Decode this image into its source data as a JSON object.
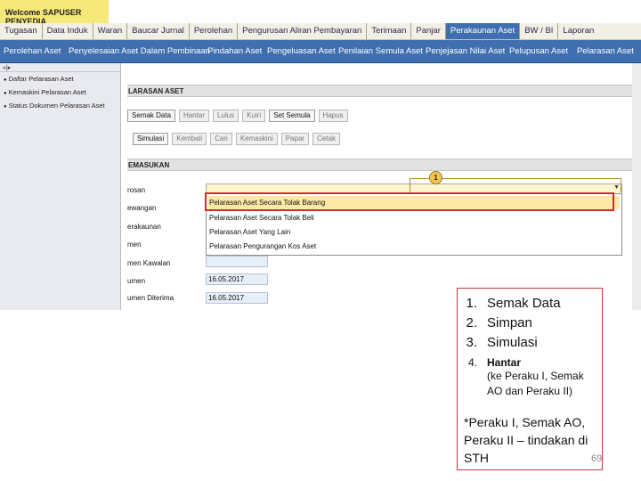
{
  "welcome": "Welcome SAPUSER PENYEDIA",
  "modules": [
    "Tugasan",
    "Data Induk",
    "Waran",
    "Baucar Jurnal",
    "Perolehan",
    "Pengurusan Aliran Pembayaran",
    "Terimaan",
    "Panjar",
    "Perakaunan Aset",
    "BW / BI",
    "Laporan"
  ],
  "active_module": "Perakaunan Aset",
  "submodules": [
    "Perolehan Aset",
    "Penyelesaian Aset Dalam Pembinaan",
    "Pindahan Aset",
    "Pengeluasan Aset",
    "Penilaian Semula Aset",
    "Penjejasan Nilai Aset",
    "Pelupusan Aset",
    "Pelarasan Aset"
  ],
  "sidebar": {
    "toolbar": "«|▸",
    "items": [
      "Daftar Pelarasan Aset",
      "Kemaskini Pelarasan Aset",
      "Status Dokumen Pelarasan Aset"
    ]
  },
  "section_title": "LARASAN ASET",
  "buttons_row1": [
    {
      "label": "Semak Data",
      "enabled": true
    },
    {
      "label": "Hantar",
      "enabled": false
    },
    {
      "label": "Lulus",
      "enabled": false
    },
    {
      "label": "Kuiri",
      "enabled": false
    },
    {
      "label": "Set Semula",
      "enabled": true
    },
    {
      "label": "Hapus",
      "enabled": false
    }
  ],
  "buttons_row2": [
    {
      "label": "Simulasi",
      "enabled": true
    },
    {
      "label": "Kembali",
      "enabled": false
    },
    {
      "label": "Cari",
      "enabled": false
    },
    {
      "label": "Kemaskini",
      "enabled": false
    },
    {
      "label": "Papar",
      "enabled": false
    },
    {
      "label": "Cetak",
      "enabled": false
    }
  ],
  "input_section_title": "EMASUKAN",
  "field_labels": [
    "rosan",
    "ewangan",
    "erakaunan",
    "men",
    "men Kawalan",
    "umen",
    "umen Diterima"
  ],
  "dropdown_options": [
    "Pelarasan Aset Secara Tolak Barang",
    "Pelarasan Aset Secara Tolak Beli",
    "Pelarasan Aset Yang Lain",
    "Pelarasan Pengurangan Kos Aset"
  ],
  "selected_option": "Pelarasan Aset Secara Tolak Barang",
  "callout_number": "1",
  "dates": [
    "16.05.2017",
    "16.05.2017"
  ],
  "note": {
    "items": [
      {
        "num": "1.",
        "text": "Semak Data"
      },
      {
        "num": "2.",
        "text": "Simpan"
      },
      {
        "num": "3.",
        "text": "Simulasi"
      },
      {
        "num": "4.",
        "text": "Hantar",
        "sub": "(ke Peraku I, Semak AO dan Peraku II)"
      }
    ],
    "footnote": "*Peraku I, Semak AO, Peraku II – tindakan di STH",
    "page": "69"
  },
  "colors": {
    "module_active_bg": "#3f6fb0",
    "welcome_bg": "#f5e77a",
    "highlight_frame": "#d22b2b",
    "selected_option_bg": "#fde9a6"
  }
}
